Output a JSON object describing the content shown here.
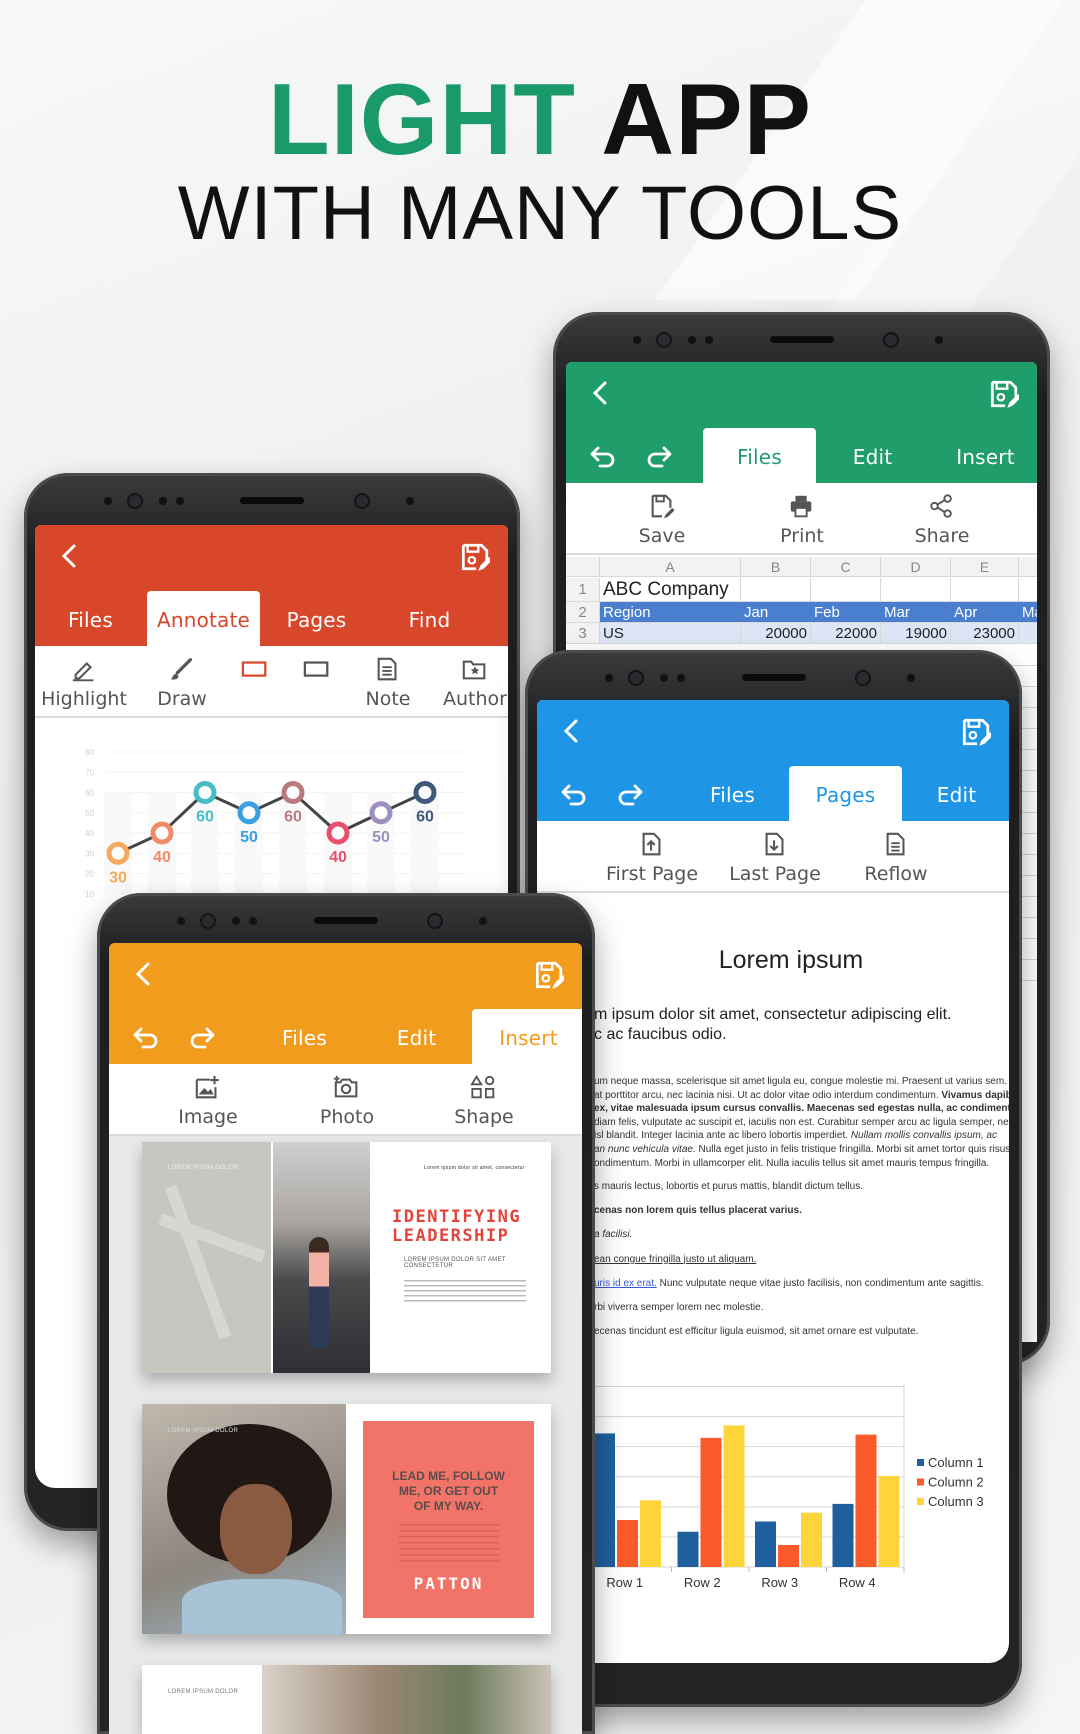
{
  "headline": {
    "accent": "LIGHT",
    "main": "APP",
    "subtitle": "WITH MANY TOOLS"
  },
  "colors": {
    "accent_green": "#1a9a6a",
    "sheet_header": "#1f9d6b",
    "annotate_header": "#d9472b",
    "pages_header": "#1f95e6",
    "insert_header": "#f29c1d",
    "sheet_table_header": "#4a7fd0",
    "sheet_row_fill": "#dde6f7"
  },
  "phones": {
    "sheet": {
      "tabs": [
        "Files",
        "Edit",
        "Insert"
      ],
      "active_tab": 0,
      "has_undo": true,
      "tools": [
        {
          "label": "Save",
          "icon": "save-icon"
        },
        {
          "label": "Print",
          "icon": "print-icon"
        },
        {
          "label": "Share",
          "icon": "share-icon"
        }
      ]
    },
    "annotate": {
      "tabs": [
        "Files",
        "Annotate",
        "Pages",
        "Find"
      ],
      "active_tab": 1,
      "has_undo": false,
      "tools": [
        {
          "label": "Highlight",
          "icon": "highlight-icon"
        },
        {
          "label": "Draw",
          "icon": "draw-icon"
        },
        {
          "icon": "rectangle-red-icon"
        },
        {
          "icon": "rectangle-icon"
        },
        {
          "label": "Note",
          "icon": "note-icon"
        },
        {
          "label": "Author",
          "icon": "author-icon"
        }
      ]
    },
    "pages": {
      "tabs": [
        "Files",
        "Pages",
        "Edit"
      ],
      "active_tab": 1,
      "has_undo": true,
      "tools": [
        {
          "label": "First Page",
          "icon": "first-page-icon"
        },
        {
          "label": "Last Page",
          "icon": "last-page-icon"
        },
        {
          "label": "Reflow",
          "icon": "reflow-icon"
        }
      ]
    },
    "insert": {
      "tabs": [
        "Files",
        "Edit",
        "Insert"
      ],
      "active_tab": 2,
      "has_undo": true,
      "tools": [
        {
          "label": "Image",
          "icon": "image-icon"
        },
        {
          "label": "Photo",
          "icon": "photo-icon"
        },
        {
          "label": "Shape",
          "icon": "shape-icon"
        }
      ]
    }
  },
  "spreadsheet": {
    "columns": [
      "A",
      "B",
      "C",
      "D",
      "E"
    ],
    "rows": [
      {
        "num": "1",
        "cells": [
          "ABC Company",
          "",
          "",
          "",
          "",
          ""
        ]
      },
      {
        "num": "2",
        "cells": [
          "Region",
          "Jan",
          "Feb",
          "Mar",
          "Apr",
          "Ma"
        ]
      },
      {
        "num": "3",
        "cells": [
          "US",
          "20000",
          "22000",
          "19000",
          "23000",
          ""
        ]
      }
    ]
  },
  "document": {
    "title": "Lorem ipsum",
    "lead": [
      "m ipsum dolor sit amet, consectetur adipiscing elit.",
      "c ac faucibus odio."
    ],
    "paragraph": [
      [
        {
          "t": "um neque massa, scelerisque sit amet ligula eu, congue molestie mi. Praesent ut varius sem."
        }
      ],
      [
        {
          "t": "at porttitor arcu, nec lacinia nisi. Ut ac dolor vitae odio interdum condimentum. "
        },
        {
          "t": "Vivamus dapibus",
          "s": "bold"
        }
      ],
      [
        {
          "t": "ex, vitae malesuada ipsum cursus convallis. Maecenas sed egestas nulla, ac condimentum orci.",
          "s": "bold"
        }
      ],
      [
        {
          "t": "diam felis, vulputate ac suscipit et, iaculis non est. Curabitur semper arcu ac ligula semper, nec"
        }
      ],
      [
        {
          "t": "isl blandit. Integer lacinia ante ac libero lobortis imperdiet. "
        },
        {
          "t": "Nullam mollis convallis ipsum, ac",
          "s": "italic"
        }
      ],
      [
        {
          "t": "an nunc vehicula vitae.",
          "s": "italic"
        },
        {
          "t": " Nulla eget justo in felis tristique fringilla. Morbi sit amet tortor quis risus"
        }
      ],
      [
        {
          "t": "ondimentum. Morbi in ullamcorper elit. Nulla iaculis tellus sit amet mauris tempus fringilla."
        }
      ]
    ],
    "lines": [
      [
        {
          "t": "s mauris lectus, lobortis et purus mattis, blandit dictum tellus."
        }
      ],
      [
        {
          "t": "cenas non lorem quis tellus placerat varius.",
          "s": "bold"
        }
      ],
      [
        {
          "t": "a facilisi.",
          "s": "italic"
        }
      ],
      [
        {
          "t": "ean congue fringilla justo ut aliquam.",
          "s": "underline"
        }
      ],
      [
        {
          "t": "uris id ex erat.",
          "s": "link"
        },
        {
          "t": " Nunc vulputate neque vitae justo facilisis, non condimentum ante sagittis."
        }
      ],
      [
        {
          "t": "rbi viverra semper lorem nec molestie."
        }
      ],
      [
        {
          "t": "ecenas tincidunt est efficitur ligula euismod, sit amet ornare est vulputate."
        }
      ]
    ]
  },
  "slides": {
    "s1": {
      "brand": "LOREM IPSUM DOLOR",
      "kicker": "Lorem ipsum dolor sit amet, consectetur",
      "title_1": "IDENTIFYING",
      "title_2": "LEADERSHIP",
      "sub_1": "LOREM IPSUM DOLOR SIT AMET",
      "sub_2": "CONSECTETUR"
    },
    "s2": {
      "brand": "LOREM IPSUM DOLOR",
      "quote": [
        "LEAD ME, FOLLOW",
        "ME, OR GET OUT",
        "OF MY WAY."
      ],
      "author": "PATTON"
    },
    "s3": {
      "brand": "LOREM IPSUM DOLOR"
    }
  },
  "chart_data": [
    {
      "type": "line",
      "yticks": [
        80,
        70,
        60,
        50,
        40,
        30,
        20,
        10
      ],
      "ylim": [
        10,
        80
      ],
      "values": [
        30,
        40,
        60,
        50,
        60,
        40,
        50,
        60
      ],
      "point_colors": [
        "#f6a95c",
        "#f08a68",
        "#45bcc6",
        "#3a9fe0",
        "#b97a7e",
        "#e8506e",
        "#9d8fc0",
        "#3f5a7c"
      ],
      "data_labels": [
        "30",
        "40",
        "60",
        "50",
        "60",
        "40",
        "50",
        "60"
      ]
    },
    {
      "type": "bar",
      "categories": [
        "Row 1",
        "Row 2",
        "Row 3",
        "Row 4"
      ],
      "series": [
        {
          "name": "Column 1",
          "values": [
            9.1,
            2.4,
            3.1,
            4.3
          ],
          "color": "#1f5f9e"
        },
        {
          "name": "Column 2",
          "values": [
            3.2,
            8.8,
            1.5,
            9.02
          ],
          "color": "#fb5a2a"
        },
        {
          "name": "Column 3",
          "values": [
            4.54,
            9.65,
            3.7,
            6.2
          ],
          "color": "#fdd43a"
        }
      ],
      "ylim": [
        0,
        12
      ],
      "grid": true,
      "legend": "right"
    }
  ]
}
